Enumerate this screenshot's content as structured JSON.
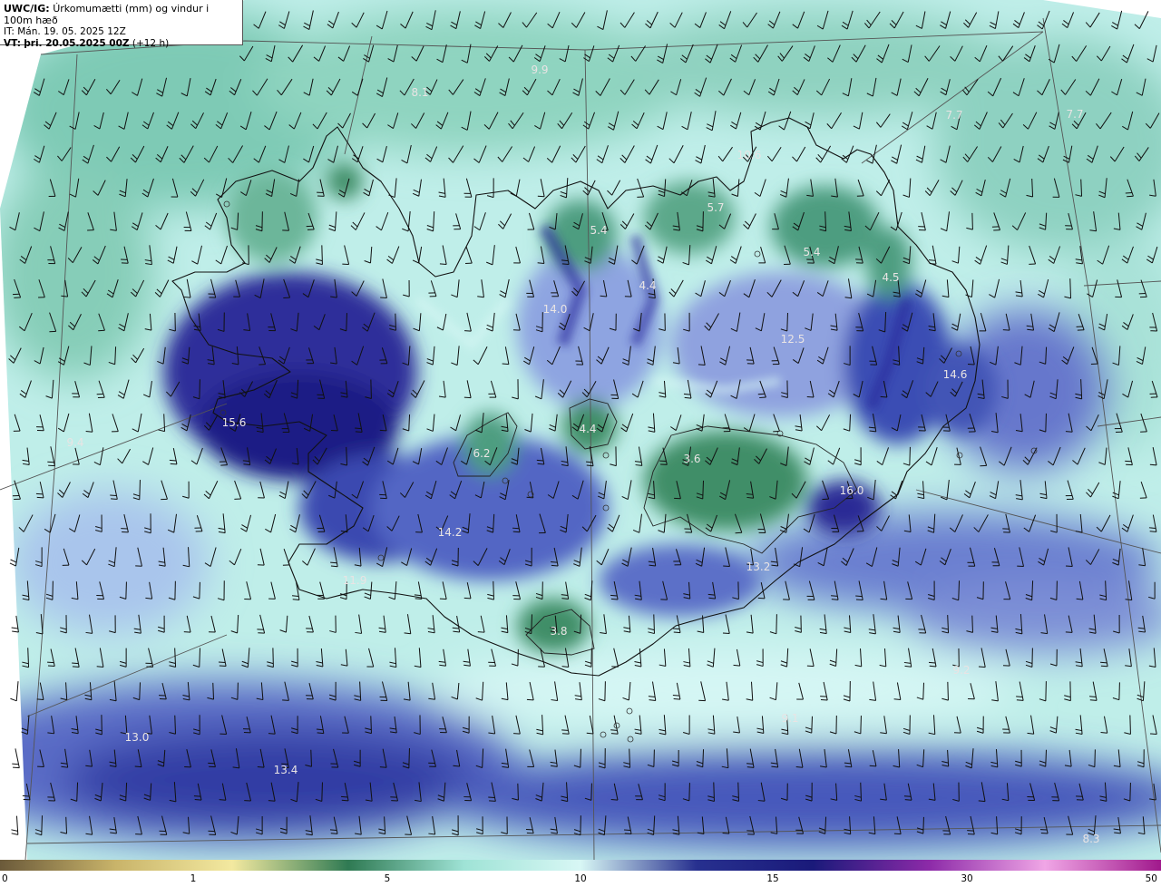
{
  "header": {
    "product_label": "UWC/IG:",
    "product_title": "Úrkomumætti (mm) og vindur i 100m hæð",
    "it_label": "IT:",
    "it_value": "Mán. 19. 05. 2025 12Z",
    "vt_label": "VT:",
    "vt_value": "þri. 20.05.2025 00Z",
    "vt_offset": "(+12 h)"
  },
  "map_labels": [
    {
      "text": "9.9",
      "value": 9.9
    },
    {
      "text": "8.1",
      "value": 8.1
    },
    {
      "text": "7.7",
      "value": 7.7
    },
    {
      "text": "7.7",
      "value": 7.7
    },
    {
      "text": "10.6",
      "value": 10.6
    },
    {
      "text": "5.7",
      "value": 5.7
    },
    {
      "text": "5.4",
      "value": 5.4
    },
    {
      "text": "5.4",
      "value": 5.4
    },
    {
      "text": "4.5",
      "value": 4.5
    },
    {
      "text": "4.4",
      "value": 4.4
    },
    {
      "text": "14.0",
      "value": 14.0
    },
    {
      "text": "12.5",
      "value": 12.5
    },
    {
      "text": "14.6",
      "value": 14.6
    },
    {
      "text": "15.6",
      "value": 15.6
    },
    {
      "text": "4.4",
      "value": 4.4
    },
    {
      "text": "6.2",
      "value": 6.2
    },
    {
      "text": "3.6",
      "value": 3.6
    },
    {
      "text": "16.0",
      "value": 16.0
    },
    {
      "text": "9.4",
      "value": 9.4
    },
    {
      "text": "14.2",
      "value": 14.2
    },
    {
      "text": "13.2",
      "value": 13.2
    },
    {
      "text": "11.9",
      "value": 11.9
    },
    {
      "text": "3.8",
      "value": 3.8
    },
    {
      "text": "9.2",
      "value": 9.2
    },
    {
      "text": "9.1",
      "value": 9.1
    },
    {
      "text": "13.0",
      "value": 13.0
    },
    {
      "text": "13.4",
      "value": 13.4
    },
    {
      "text": "8.3",
      "value": 8.3
    }
  ],
  "colorbar": {
    "ticks": [
      "0",
      "1",
      "5",
      "10",
      "15",
      "30",
      "50"
    ],
    "stops": [
      "#6b5a3a",
      "#c9b46a",
      "#f3e9a0",
      "#2f7a53",
      "#9fe3d6",
      "#d8f7f5",
      "#27308f",
      "#1a1a7a",
      "#8c2aa8",
      "#f0a6e6",
      "#a0198c"
    ]
  },
  "colors": {
    "deep_blue": "#20208f",
    "mid_blue": "#5a6cc6",
    "light_cyan": "#c7f2ee",
    "teal_green": "#4e9d80",
    "dark_green": "#2f7a53"
  },
  "icons": {
    "wind_barb": "wind-barb-icon",
    "calm": "calm-circle-icon"
  }
}
